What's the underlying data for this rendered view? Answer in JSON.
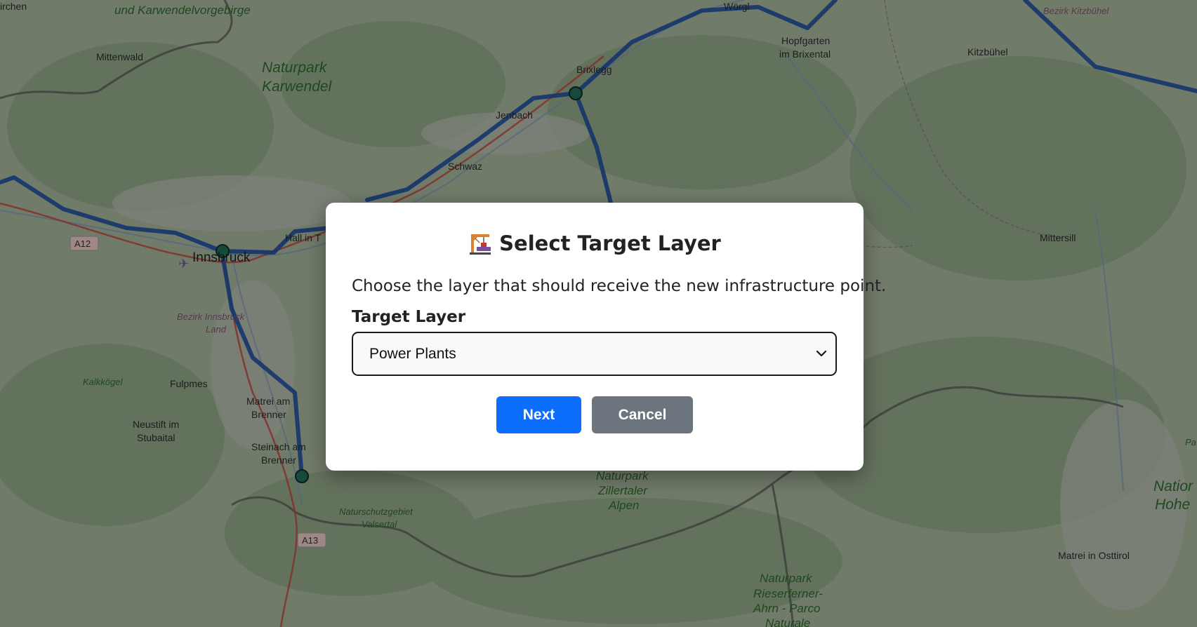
{
  "map": {
    "places": [
      "irchen",
      "Mittenwald",
      "Wörgl",
      "Hopfgarten",
      "im Brixental",
      "Kitzbühel",
      "Brixlegg",
      "Jenbach",
      "Schwaz",
      "Hall in T",
      "Innsbruck",
      "Mittersill",
      "Fulpmes",
      "Matrei am",
      "Brenner",
      "Neustift im",
      "Stubaital",
      "Steinach am",
      "Brenner",
      "Matrei in Osttirol",
      "Pa"
    ],
    "parks": [
      "und Karwendelvorgebirge",
      "Naturpark",
      "Karwendel",
      "Kalkkögel",
      "Naturpark",
      "Zillertaler",
      "Alpen",
      "Naturschutzgebiet",
      "Valsertal",
      "Natior",
      "Hohe",
      "Naturpark",
      "Rieserferner-",
      "Ahrn - Parco",
      "Naturale"
    ],
    "districts": [
      "Bezirk Innsbruck",
      "Land",
      "Bezirk Kitzbühel"
    ],
    "road_shields": [
      "A12",
      "A13"
    ],
    "route_color": "#1f4f9e",
    "node_color": "#1f6e5a"
  },
  "dialog": {
    "icon": "construction-crane-icon",
    "title": "Select Target Layer",
    "description": "Choose the layer that should receive the new infrastructure point.",
    "field_label": "Target Layer",
    "select_value": "Power Plants",
    "next_label": "Next",
    "cancel_label": "Cancel",
    "accent_color": "#0d6efd",
    "secondary_color": "#6c757d"
  }
}
